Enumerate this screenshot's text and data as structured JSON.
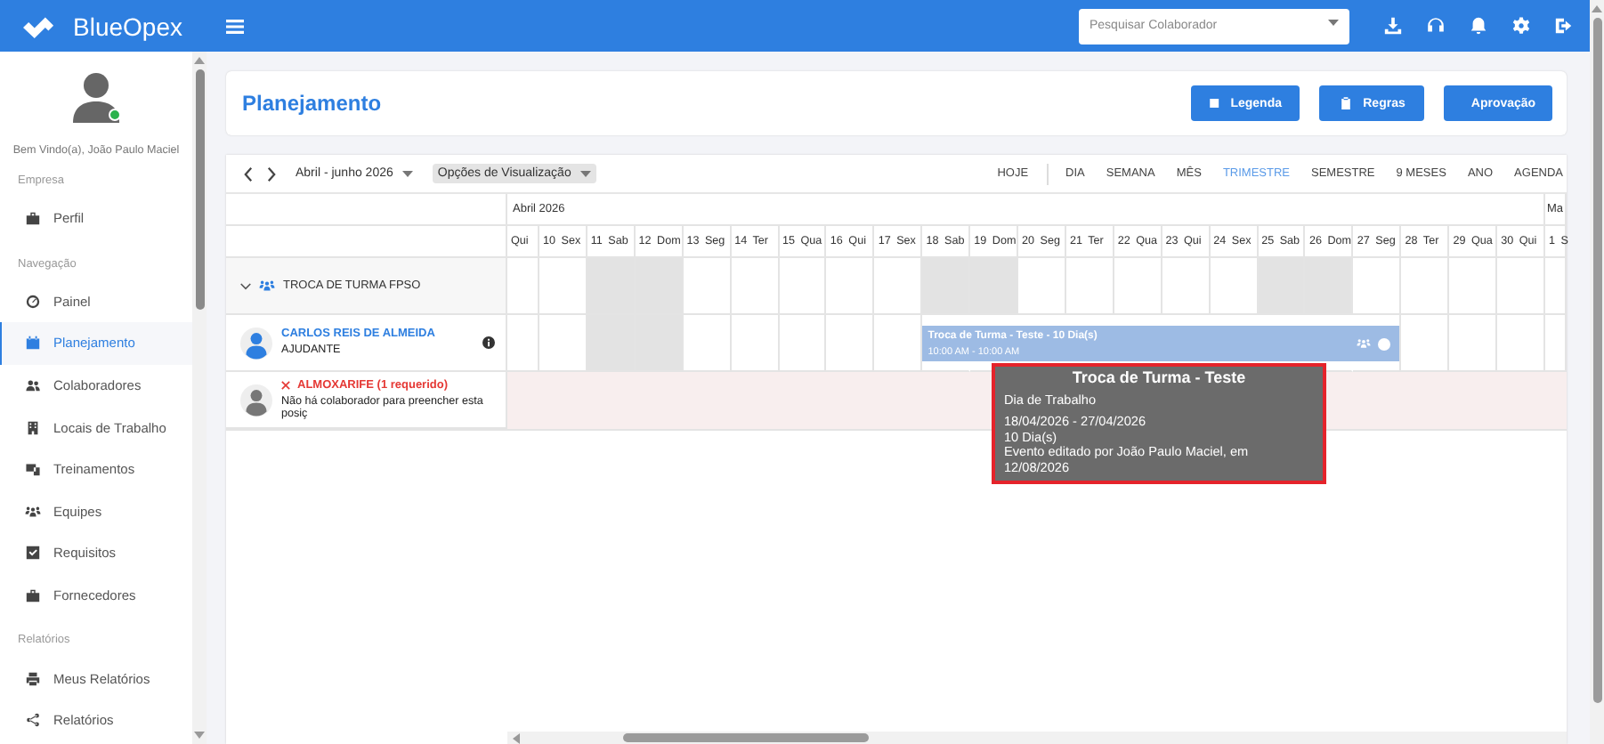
{
  "topbar": {
    "brand": "BlueOpex",
    "search": {
      "placeholder": "Pesquisar Colaborador"
    }
  },
  "sidebar": {
    "user": {
      "greeting": "Bem Vindo(a), João Paulo Maciel",
      "online": true
    },
    "sections": [
      {
        "title": "Empresa",
        "items": [
          {
            "label": "Perfil",
            "selected": false
          }
        ]
      },
      {
        "title": "Navegação",
        "items": [
          {
            "label": "Painel",
            "selected": false
          },
          {
            "label": "Planejamento",
            "selected": true
          },
          {
            "label": "Colaboradores",
            "selected": false
          },
          {
            "label": "Locais de Trabalho",
            "selected": false
          },
          {
            "label": "Treinamentos",
            "selected": false
          },
          {
            "label": "Equipes",
            "selected": false
          },
          {
            "label": "Requisitos",
            "selected": false
          },
          {
            "label": "Fornecedores",
            "selected": false
          }
        ]
      },
      {
        "title": "Relatórios",
        "items": [
          {
            "label": "Meus Relatórios",
            "selected": false
          },
          {
            "label": "Relatórios",
            "selected": false
          }
        ]
      }
    ]
  },
  "page": {
    "title": "Planejamento",
    "buttons": [
      "Legenda",
      "Regras",
      "Aprovação"
    ]
  },
  "calendar": {
    "period": "Abril - junho 2026",
    "options": "Opções de Visualização",
    "views": [
      {
        "label": "HOJE",
        "selected": false
      },
      {
        "label": "DIA",
        "selected": false
      },
      {
        "label": "SEMANA",
        "selected": false
      },
      {
        "label": "MÊS",
        "selected": false
      },
      {
        "label": "TRIMESTRE",
        "selected": true
      },
      {
        "label": "SEMESTRE",
        "selected": false
      },
      {
        "label": "9 MESES",
        "selected": false
      },
      {
        "label": "ANO",
        "selected": false
      },
      {
        "label": "AGENDA",
        "selected": false
      }
    ],
    "months": [
      "Abril 2026",
      "Ma"
    ],
    "days": [
      {
        "label": "Qui",
        "weekend": false,
        "event": false
      },
      {
        "label": "10 Sex",
        "weekend": false,
        "event": false
      },
      {
        "label": "11 Sab",
        "weekend": true,
        "event": false
      },
      {
        "label": "12 Dom",
        "weekend": true,
        "event": false
      },
      {
        "label": "13 Seg",
        "weekend": false,
        "event": false
      },
      {
        "label": "14 Ter",
        "weekend": false,
        "event": false
      },
      {
        "label": "15 Qua",
        "weekend": false,
        "event": false
      },
      {
        "label": "16 Qui",
        "weekend": false,
        "event": false
      },
      {
        "label": "17 Sex",
        "weekend": false,
        "event": false
      },
      {
        "label": "18 Sab",
        "weekend": true,
        "event": true
      },
      {
        "label": "19 Dom",
        "weekend": true,
        "event": true
      },
      {
        "label": "20 Seg",
        "weekend": false,
        "event": true
      },
      {
        "label": "21 Ter",
        "weekend": false,
        "event": true
      },
      {
        "label": "22 Qua",
        "weekend": false,
        "event": true
      },
      {
        "label": "23 Qui",
        "weekend": false,
        "event": true
      },
      {
        "label": "24 Sex",
        "weekend": false,
        "event": true
      },
      {
        "label": "25 Sab",
        "weekend": true,
        "event": true
      },
      {
        "label": "26 Dom",
        "weekend": true,
        "event": true
      },
      {
        "label": "27 Seg",
        "weekend": false,
        "event": true
      },
      {
        "label": "28 Ter",
        "weekend": false,
        "event": false
      },
      {
        "label": "29 Qua",
        "weekend": false,
        "event": false
      },
      {
        "label": "30 Qui",
        "weekend": false,
        "event": false
      },
      {
        "label": "1 S",
        "weekend": false,
        "event": false
      }
    ],
    "group": {
      "title": "TROCA DE TURMA FPSO",
      "expanded": true
    },
    "rows": [
      {
        "kind": "employee",
        "name": "CARLOS REIS DE ALMEIDA",
        "role": "AJUDANTE",
        "event": {
          "title": "Troca de Turma - Teste - 10 Dia(s)",
          "time": "10:00 AM - 10:00 AM"
        }
      },
      {
        "kind": "vacancy",
        "name": "ALMOXARIFE (1 requerido)",
        "note": "Não há colaborador para preencher esta posiç"
      }
    ],
    "tooltip": {
      "title": "Troca de Turma - Teste",
      "type": "Dia de Trabalho",
      "dates": "18/04/2026 - 27/04/2026",
      "duration": "10 Dia(s)",
      "edited": "Evento editado por João Paulo Maciel, em 12/08/2026"
    }
  }
}
